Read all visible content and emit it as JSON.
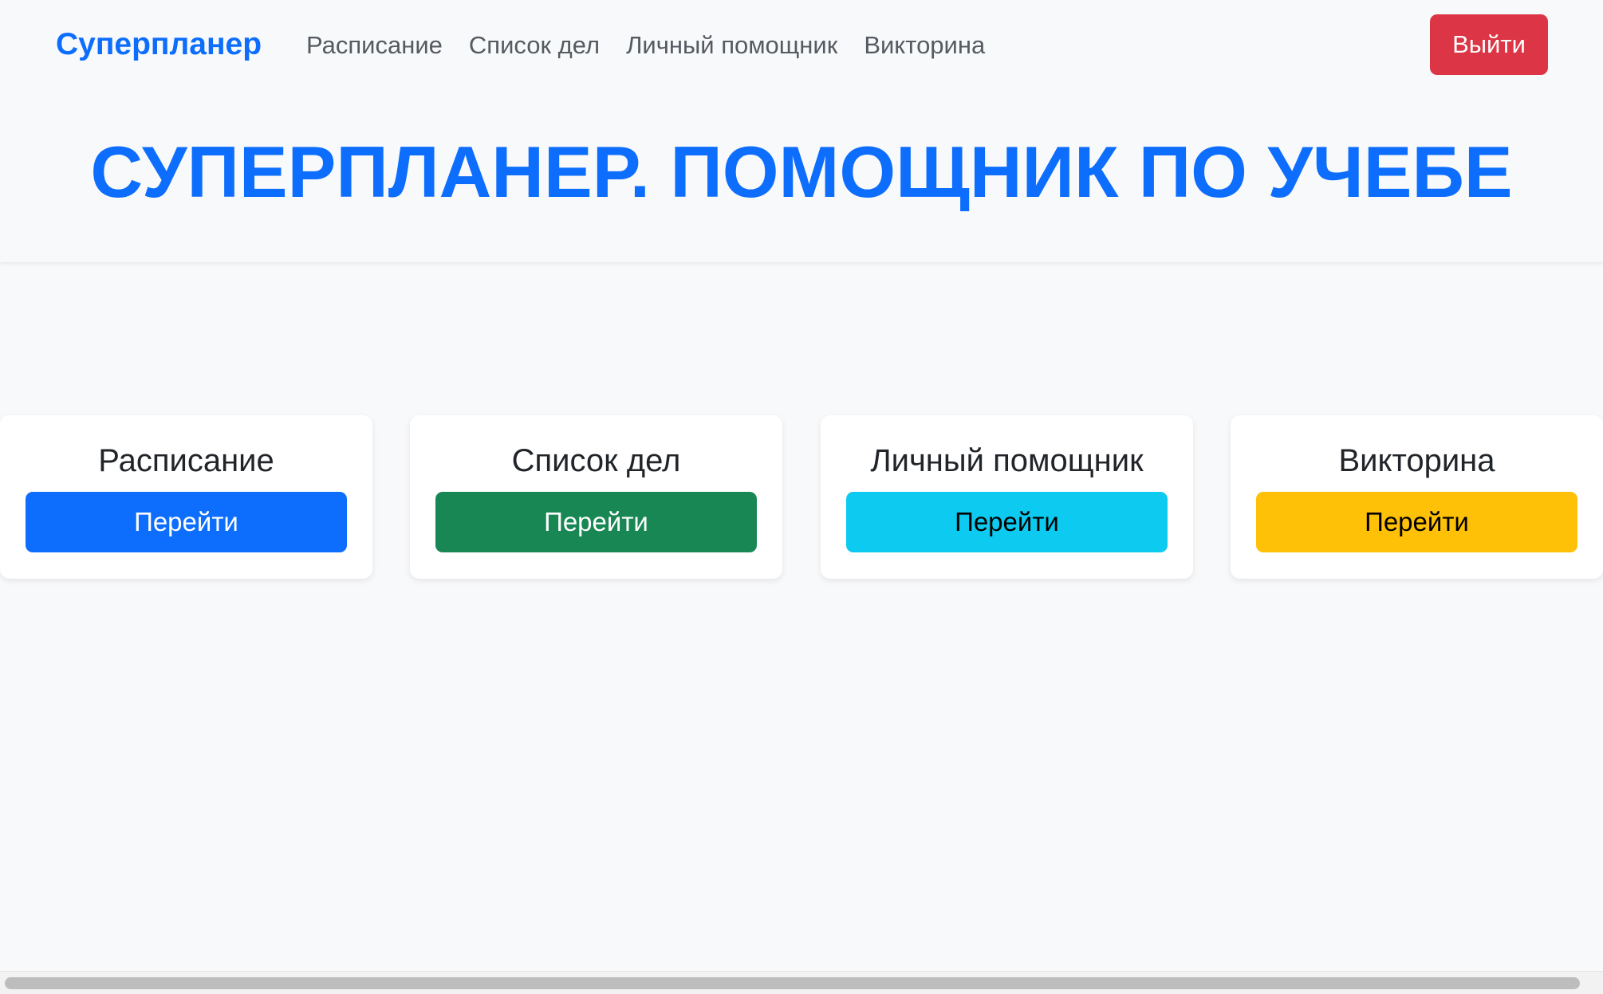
{
  "navbar": {
    "brand": "Суперпланер",
    "links": [
      {
        "label": "Расписание"
      },
      {
        "label": "Список дел"
      },
      {
        "label": "Личный помощник"
      },
      {
        "label": "Викторина"
      }
    ],
    "logout_label": "Выйти"
  },
  "hero": {
    "title": "СУПЕРПЛАНЕР. ПОМОЩНИК ПО УЧЕБЕ"
  },
  "cards": [
    {
      "title": "Расписание",
      "button_label": "Перейти",
      "button_color": "#0d6efd",
      "button_text_color": "#ffffff"
    },
    {
      "title": "Список дел",
      "button_label": "Перейти",
      "button_color": "#198754",
      "button_text_color": "#ffffff"
    },
    {
      "title": "Личный помощник",
      "button_label": "Перейти",
      "button_color": "#0dcaf0",
      "button_text_color": "#000000"
    },
    {
      "title": "Викторина",
      "button_label": "Перейти",
      "button_color": "#ffc107",
      "button_text_color": "#000000"
    }
  ],
  "colors": {
    "brand": "#0d6efd",
    "danger": "#dc3545",
    "background": "#f8f9fa"
  }
}
